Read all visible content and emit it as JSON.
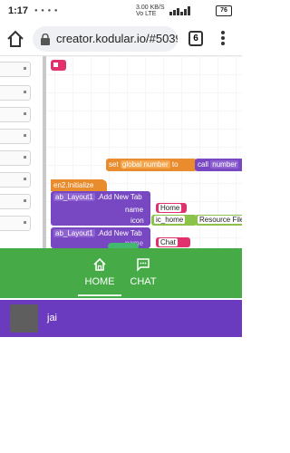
{
  "status_bar": {
    "time": "1:17",
    "network_speed": "3.00 KB/S",
    "network_type": "Vo LTE",
    "battery_level": "76"
  },
  "browser": {
    "url": "creator.kodular.io/#5039",
    "tab_count": "6"
  },
  "blocks": {
    "set_label": "set",
    "global_var": "global number",
    "to_label": "to",
    "call_label": "call",
    "call_target": "number",
    "initialize_label": ".Initialize",
    "initialize_component": "en2",
    "add_tab_1_component": "ab_Layout1",
    "add_tab_1_method": ".Add New Tab",
    "name_label": "name",
    "name_value_1": "Home",
    "icon_label": "icon",
    "icon_value": "ic_home",
    "resource_label": "Resource File",
    "add_tab_2_component": "ab_Layout1",
    "add_tab_2_method": ".Add New Tab",
    "name_label_2": "name",
    "name_value_2": "Chat"
  },
  "tabs": [
    {
      "label": "HOME",
      "icon": "home-icon",
      "active": true
    },
    {
      "label": "CHAT",
      "icon": "chat-icon",
      "active": false
    }
  ],
  "list": {
    "name": "jai"
  },
  "colors": {
    "tab_bar": "#46ab47",
    "row": "#6b3bbf",
    "block_pink": "#e0306d",
    "block_orange": "#e98c2e",
    "block_purple": "#7748c2"
  }
}
